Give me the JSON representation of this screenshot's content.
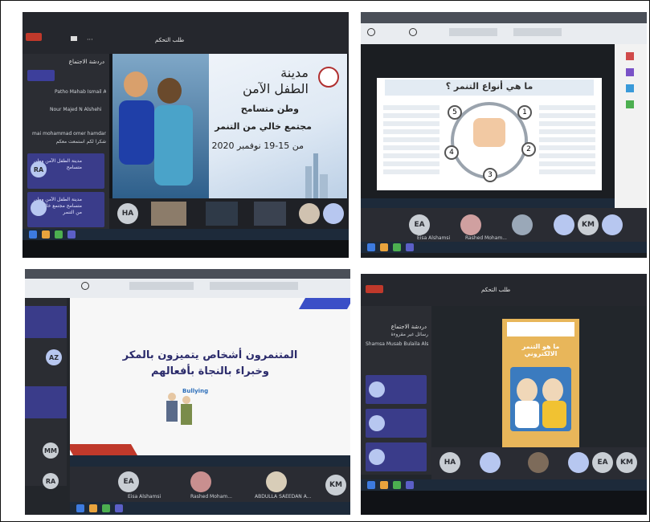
{
  "colors": {
    "teams_purple": "#3a3c8a",
    "chat_bg": "#2b2d33",
    "taskbar": "#1d2a3a",
    "avatar_blue": "#b7c7f0",
    "avatar_grey": "#c9ced4"
  },
  "top_left": {
    "meeting_title": "طلب التحكم",
    "chat_title": "دردشة الاجتماع",
    "chat_entries": [
      "Patho Mahab Ismail Ali",
      "Nour Majed N Alshehi",
      "mai mohammad omer hamdan",
      "شكرا لكم استمعت معكم"
    ],
    "messages": [
      {
        "text": "مدينة الطفل الآمن وطن متسامح",
        "avatar": "RA"
      },
      {
        "text": "مدينة الطفل الآمن وطن متسامح مجتمع خالي من التنمر",
        "avatar": ""
      }
    ],
    "slide": {
      "title1": "مدينة",
      "title2": "الطفل الآمن",
      "line3": "وطن متسامح",
      "line4": "مجتمع خالي من التنمر",
      "dates": "من 15-19 نوفمبر 2020"
    },
    "participants": [
      "HA",
      "",
      "",
      "",
      "",
      ""
    ]
  },
  "top_right": {
    "doc_title": "ما هي أنواع التنمر ؟",
    "numbers": [
      "1",
      "2",
      "3",
      "4",
      "5"
    ],
    "participants": [
      "EA",
      "",
      "",
      "KM",
      ""
    ],
    "names": [
      "Eisa Alshamsi",
      "Rashed Moham..."
    ]
  },
  "bottom_left": {
    "slide_line1": "المتنمرون أشخاص يتميزون بالمكر",
    "slide_line2": "وخبراء بالنجاة بأفعالهم",
    "bullying_label": "Bullying",
    "avatars": [
      "AZ",
      "MM",
      "RA",
      "EA",
      "KM"
    ],
    "names": [
      "Eisa Alshamsi",
      "Rashed Moham...",
      "ABDULLA SAEEDAN A..."
    ]
  },
  "bottom_right": {
    "meeting_title": "طلب التحكم",
    "chat_title": "دردشة الاجتماع",
    "chat_entries": [
      "Shamsa Musab Bulaila Alsayari",
      "رسائل غير مقروءة"
    ],
    "poster_title": "ما هو التنمر الالكتروني",
    "participants": [
      "HA",
      "",
      "",
      "",
      "EA",
      "KM"
    ]
  }
}
